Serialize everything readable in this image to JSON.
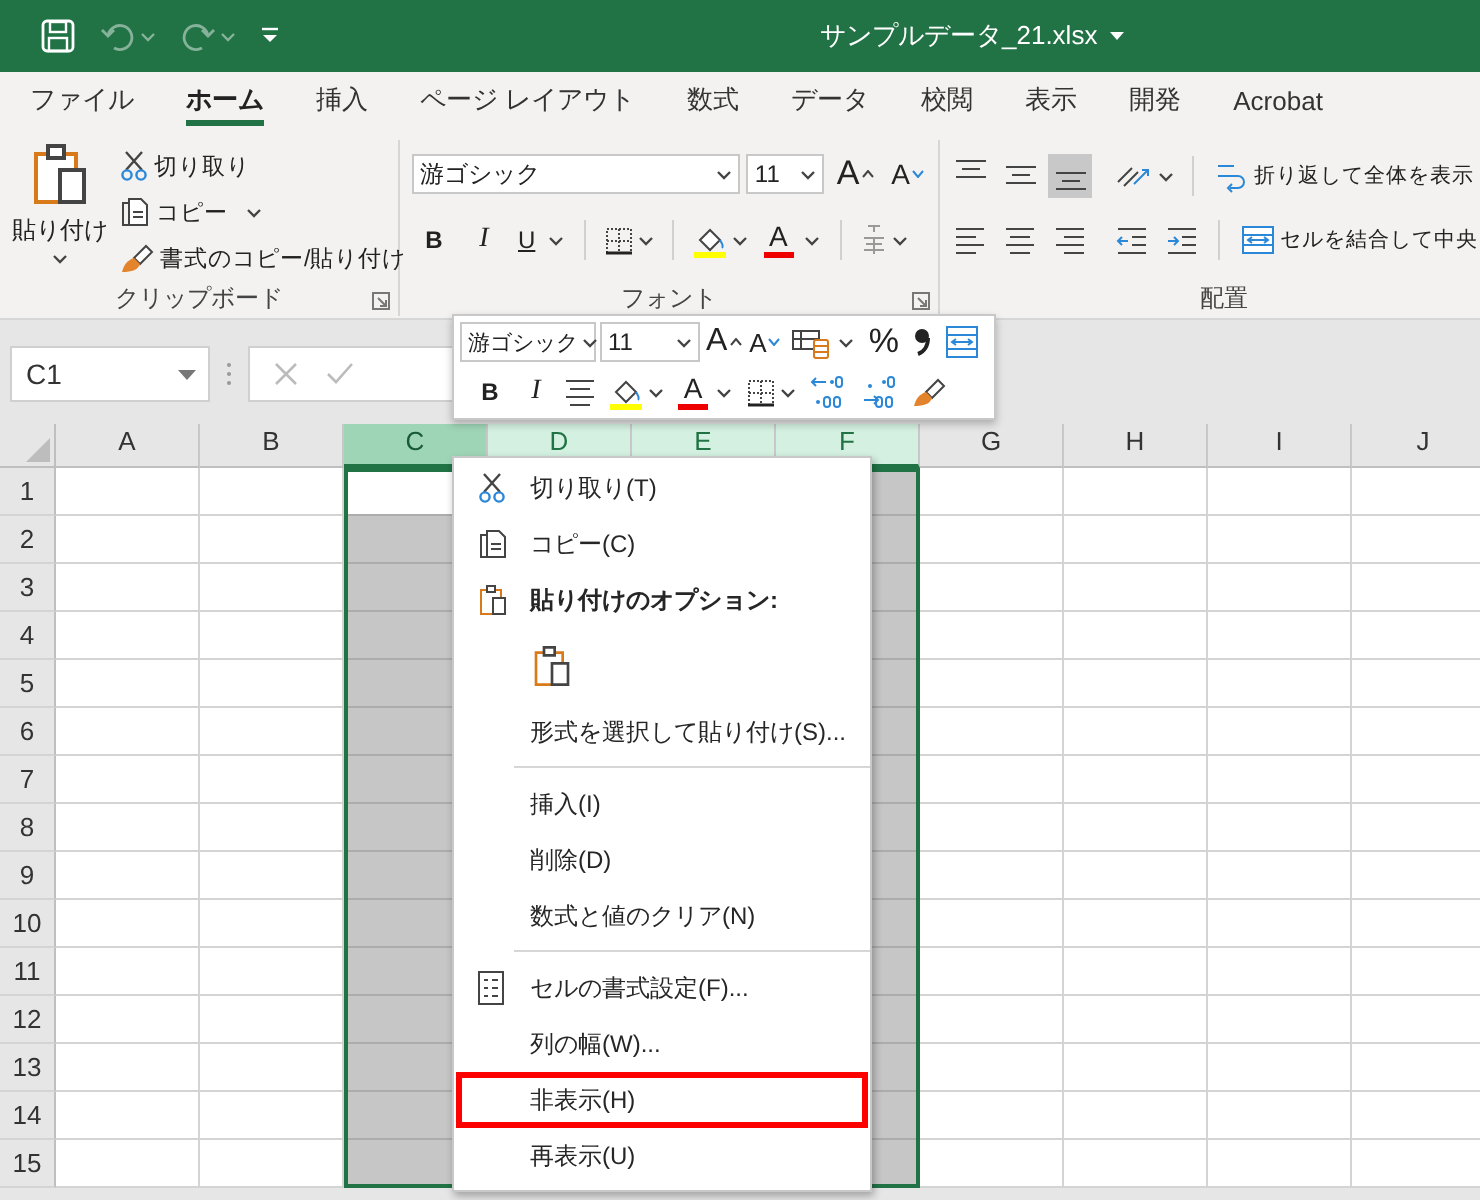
{
  "title_bar": {
    "quick_access": [
      {
        "kind": "save",
        "disabled": false
      },
      {
        "kind": "undo",
        "disabled": true
      },
      {
        "kind": "redo",
        "disabled": true
      },
      {
        "kind": "customize",
        "disabled": false
      }
    ],
    "title": "サンプルデータ_21.xlsx"
  },
  "tabs": [
    {
      "label": "ファイル",
      "selected": false
    },
    {
      "label": "ホーム",
      "selected": true
    },
    {
      "label": "挿入",
      "selected": false
    },
    {
      "label": "ページ レイアウト",
      "selected": false
    },
    {
      "label": "数式",
      "selected": false
    },
    {
      "label": "データ",
      "selected": false
    },
    {
      "label": "校閲",
      "selected": false
    },
    {
      "label": "表示",
      "selected": false
    },
    {
      "label": "開発",
      "selected": false
    },
    {
      "label": "Acrobat",
      "selected": false
    }
  ],
  "ribbon": {
    "clipboard": {
      "label": "クリップボード",
      "paste": "貼り付け",
      "commands": [
        {
          "kind": "cut",
          "label": "切り取り",
          "dropdown": false
        },
        {
          "kind": "copy",
          "label": "コピー",
          "dropdown": true
        },
        {
          "kind": "format-painter",
          "label": "書式のコピー/貼り付け",
          "dropdown": false
        }
      ]
    },
    "font": {
      "label": "フォント",
      "font_name": "游ゴシック",
      "font_size": "11",
      "grow": "A",
      "shrink": "A",
      "bold": "B",
      "italic": "I",
      "underline": "U",
      "font_color": "A"
    },
    "alignment": {
      "label": "配置",
      "vertical": [
        {
          "kind": "top",
          "selected": false
        },
        {
          "kind": "middle",
          "selected": false
        },
        {
          "kind": "bottom",
          "selected": true
        }
      ],
      "wrap_text": "折り返して全体を表示",
      "merge": "セルを結合して中央"
    }
  },
  "formula_bar": {
    "name_box": "C1"
  },
  "sheet": {
    "columns": [
      {
        "label": "A",
        "selected": false,
        "active": false
      },
      {
        "label": "B",
        "selected": false,
        "active": false
      },
      {
        "label": "C",
        "selected": true,
        "active": true
      },
      {
        "label": "D",
        "selected": true,
        "active": false
      },
      {
        "label": "E",
        "selected": true,
        "active": false
      },
      {
        "label": "F",
        "selected": true,
        "active": false
      },
      {
        "label": "G",
        "selected": false,
        "active": false
      },
      {
        "label": "H",
        "selected": false,
        "active": false
      },
      {
        "label": "I",
        "selected": false,
        "active": false
      },
      {
        "label": "J",
        "selected": false,
        "active": false
      }
    ],
    "rows": [
      {
        "label": "1",
        "active": true
      },
      {
        "label": "2",
        "active": false
      },
      {
        "label": "3",
        "active": false
      },
      {
        "label": "4",
        "active": false
      },
      {
        "label": "5",
        "active": false
      },
      {
        "label": "6",
        "active": false
      },
      {
        "label": "7",
        "active": false
      },
      {
        "label": "8",
        "active": false
      },
      {
        "label": "9",
        "active": false
      },
      {
        "label": "10",
        "active": false
      },
      {
        "label": "11",
        "active": false
      },
      {
        "label": "12",
        "active": false
      },
      {
        "label": "13",
        "active": false
      },
      {
        "label": "14",
        "active": false
      },
      {
        "label": "15",
        "active": false
      }
    ]
  },
  "mini_toolbar": {
    "font_name": "游ゴシック",
    "font_size": "11",
    "grow": "A",
    "shrink": "A",
    "percent": "%",
    "bold": "B",
    "italic": "I",
    "font_color": "A"
  },
  "context_menu": [
    {
      "kind": "cut",
      "label": "切り取り(T)",
      "highlighted": false
    },
    {
      "kind": "copy",
      "label": "コピー(C)",
      "highlighted": false
    },
    {
      "kind": "header",
      "label": "貼り付けのオプション:",
      "highlighted": false
    },
    {
      "kind": "paste-option",
      "highlighted": false
    },
    {
      "kind": "command",
      "label": "形式を選択して貼り付け(S)...",
      "highlighted": false
    },
    {
      "kind": "separator"
    },
    {
      "kind": "command",
      "label": "挿入(I)",
      "highlighted": false
    },
    {
      "kind": "command",
      "label": "削除(D)",
      "highlighted": false
    },
    {
      "kind": "command",
      "label": "数式と値のクリア(N)",
      "highlighted": false
    },
    {
      "kind": "separator"
    },
    {
      "kind": "format",
      "label": "セルの書式設定(F)...",
      "highlighted": false
    },
    {
      "kind": "command",
      "label": "列の幅(W)...",
      "highlighted": false
    },
    {
      "kind": "command",
      "label": "非表示(H)",
      "highlighted": true
    },
    {
      "kind": "command",
      "label": "再表示(U)",
      "highlighted": false
    }
  ]
}
